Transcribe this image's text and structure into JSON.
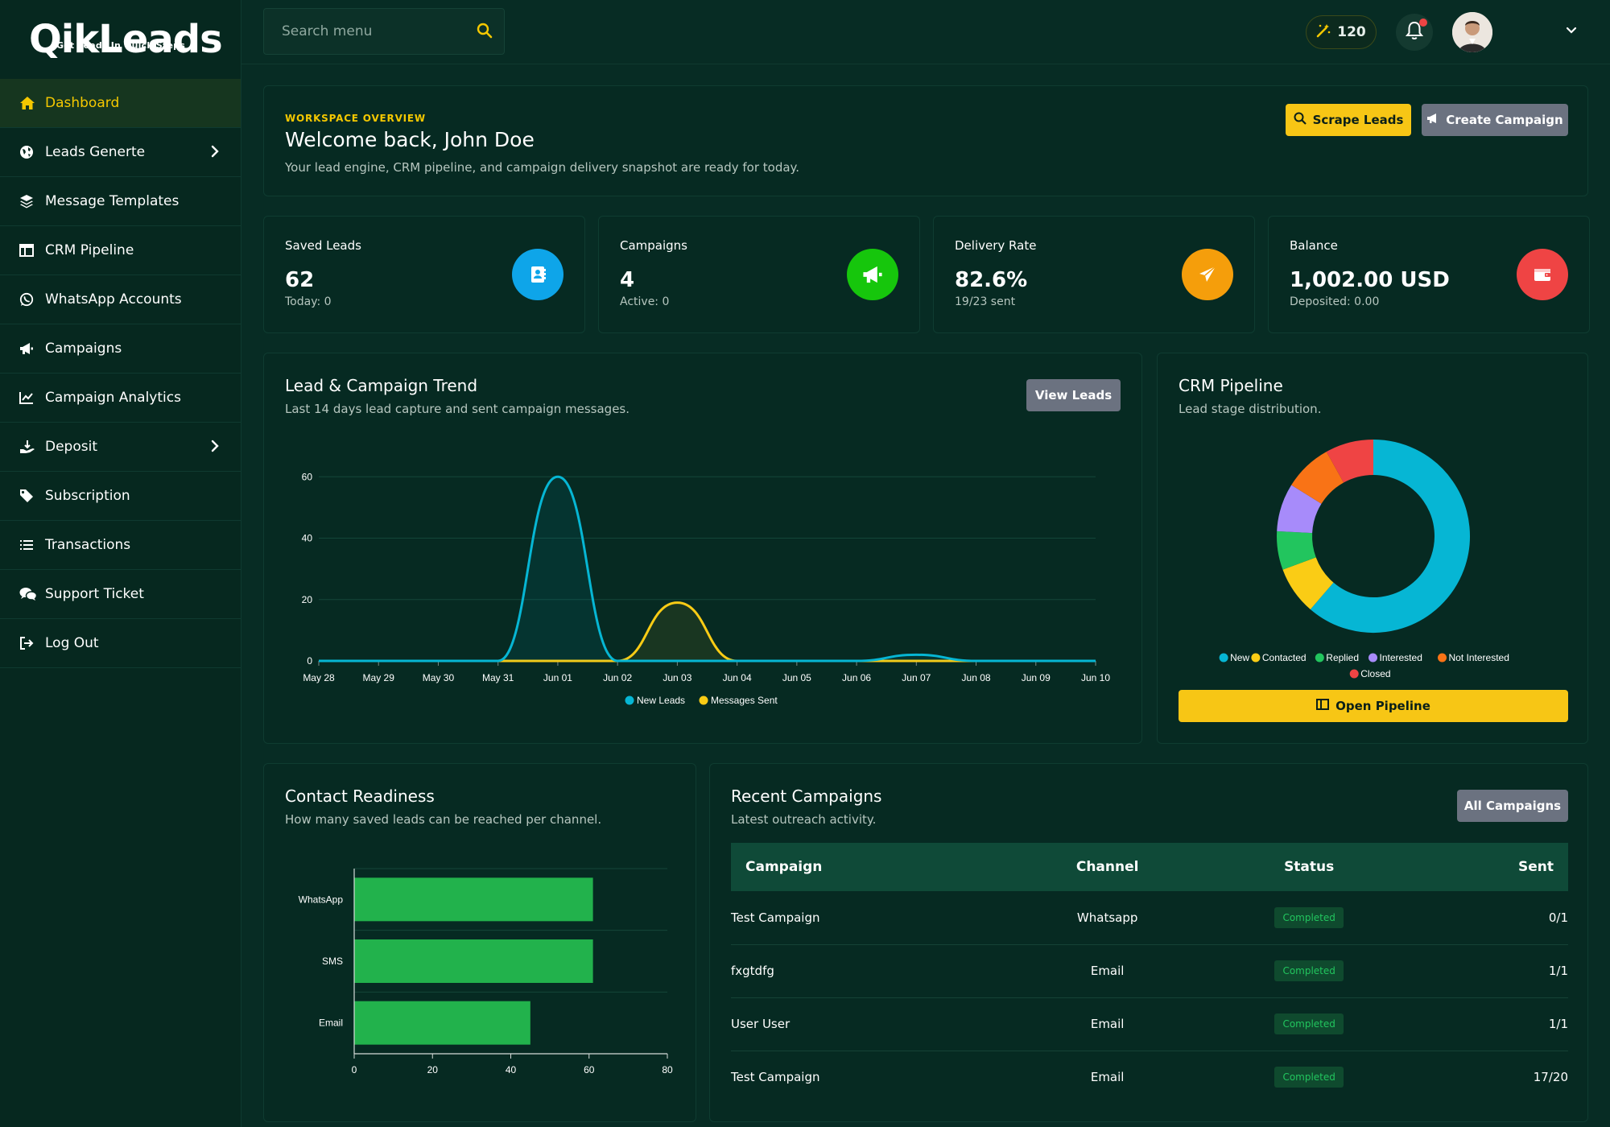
{
  "brand": {
    "name": "QikLeads",
    "tagline": "Get Leads In Quick Steps"
  },
  "sidebar": {
    "items": [
      {
        "label": "Dashboard",
        "icon": "home-icon",
        "active": true
      },
      {
        "label": "Leads Generte",
        "icon": "globe-icon",
        "has_submenu": true
      },
      {
        "label": "Message Templates",
        "icon": "layers-icon"
      },
      {
        "label": "CRM Pipeline",
        "icon": "table-icon"
      },
      {
        "label": "WhatsApp Accounts",
        "icon": "whatsapp-icon"
      },
      {
        "label": "Campaigns",
        "icon": "megaphone-icon"
      },
      {
        "label": "Campaign Analytics",
        "icon": "chart-line-icon"
      },
      {
        "label": "Deposit",
        "icon": "hand-holding-dollar-icon",
        "has_submenu": true
      },
      {
        "label": "Subscription",
        "icon": "tags-icon"
      },
      {
        "label": "Transactions",
        "icon": "list-icon"
      },
      {
        "label": "Support Ticket",
        "icon": "comments-icon"
      },
      {
        "label": "Log Out",
        "icon": "logout-icon"
      }
    ]
  },
  "topbar": {
    "search_placeholder": "Search menu",
    "credits": "120",
    "notification_dot": true
  },
  "welcome": {
    "eyebrow": "WORKSPACE OVERVIEW",
    "title": "Welcome back, John Doe",
    "subtitle": "Your lead engine, CRM pipeline, and campaign delivery snapshot are ready for today.",
    "scrape_label": "Scrape Leads",
    "create_label": "Create Campaign"
  },
  "stats": [
    {
      "label": "Saved Leads",
      "value": "62",
      "sub": "Today: 0",
      "icon": "contact-book-icon",
      "color": "#0ea5e9"
    },
    {
      "label": "Campaigns",
      "value": "4",
      "sub": "Active: 0",
      "icon": "megaphone-icon",
      "color": "#16c60c"
    },
    {
      "label": "Delivery Rate",
      "value": "82.6%",
      "sub": "19/23 sent",
      "icon": "paper-plane-icon",
      "color": "#f59e0b"
    },
    {
      "label": "Balance",
      "value": "1,002.00 USD",
      "sub": "Deposited: 0.00",
      "icon": "wallet-icon",
      "color": "#ef4444"
    }
  ],
  "trend": {
    "title": "Lead & Campaign Trend",
    "subtitle": "Last 14 days lead capture and sent campaign messages.",
    "button": "View Leads"
  },
  "pipeline": {
    "title": "CRM Pipeline",
    "subtitle": "Lead stage distribution.",
    "button": "Open Pipeline"
  },
  "readiness": {
    "title": "Contact Readiness",
    "subtitle": "How many saved leads can be reached per channel."
  },
  "recent": {
    "title": "Recent Campaigns",
    "subtitle": "Latest outreach activity.",
    "button": "All Campaigns",
    "columns": [
      "Campaign",
      "Channel",
      "Status",
      "Sent"
    ],
    "rows": [
      {
        "name": "Test Campaign",
        "channel": "Whatsapp",
        "status": "Completed",
        "sent": "0/1"
      },
      {
        "name": "fxgtdfg",
        "channel": "Email",
        "status": "Completed",
        "sent": "1/1"
      },
      {
        "name": "User User",
        "channel": "Email",
        "status": "Completed",
        "sent": "1/1"
      },
      {
        "name": "Test Campaign",
        "channel": "Email",
        "status": "Completed",
        "sent": "17/20"
      }
    ]
  },
  "chart_data": [
    {
      "type": "line",
      "x": [
        "May 28",
        "May 29",
        "May 30",
        "May 31",
        "Jun 01",
        "Jun 02",
        "Jun 03",
        "Jun 04",
        "Jun 05",
        "Jun 06",
        "Jun 07",
        "Jun 08",
        "Jun 09",
        "Jun 10"
      ],
      "series": [
        {
          "name": "New Leads",
          "color": "#06b6d4",
          "values": [
            0,
            0,
            0,
            0,
            60,
            0,
            0,
            0,
            0,
            0,
            2,
            0,
            0,
            0
          ]
        },
        {
          "name": "Messages Sent",
          "color": "#facc15",
          "values": [
            0,
            0,
            0,
            0,
            0,
            0,
            19,
            0,
            0,
            0,
            0,
            0,
            0,
            0
          ]
        }
      ],
      "yticks": [
        0,
        20,
        40,
        60
      ],
      "ylim": [
        0,
        64
      ],
      "legend": "bottom"
    },
    {
      "type": "pie",
      "donut": true,
      "labels": [
        "New",
        "Contacted",
        "Replied",
        "Interested",
        "Not Interested",
        "Closed"
      ],
      "values": [
        38,
        5,
        4,
        5,
        5,
        5
      ],
      "colors": [
        "#06b6d4",
        "#facc15",
        "#22c55e",
        "#a78bfa",
        "#f97316",
        "#ef4444"
      ],
      "legend": "bottom"
    },
    {
      "type": "bar",
      "orientation": "horizontal",
      "categories": [
        "WhatsApp",
        "SMS",
        "Email"
      ],
      "values": [
        61,
        61,
        45
      ],
      "color": "#22b24c",
      "xlim": [
        0,
        80
      ],
      "xticks": [
        0,
        20,
        40,
        60,
        80
      ]
    }
  ]
}
